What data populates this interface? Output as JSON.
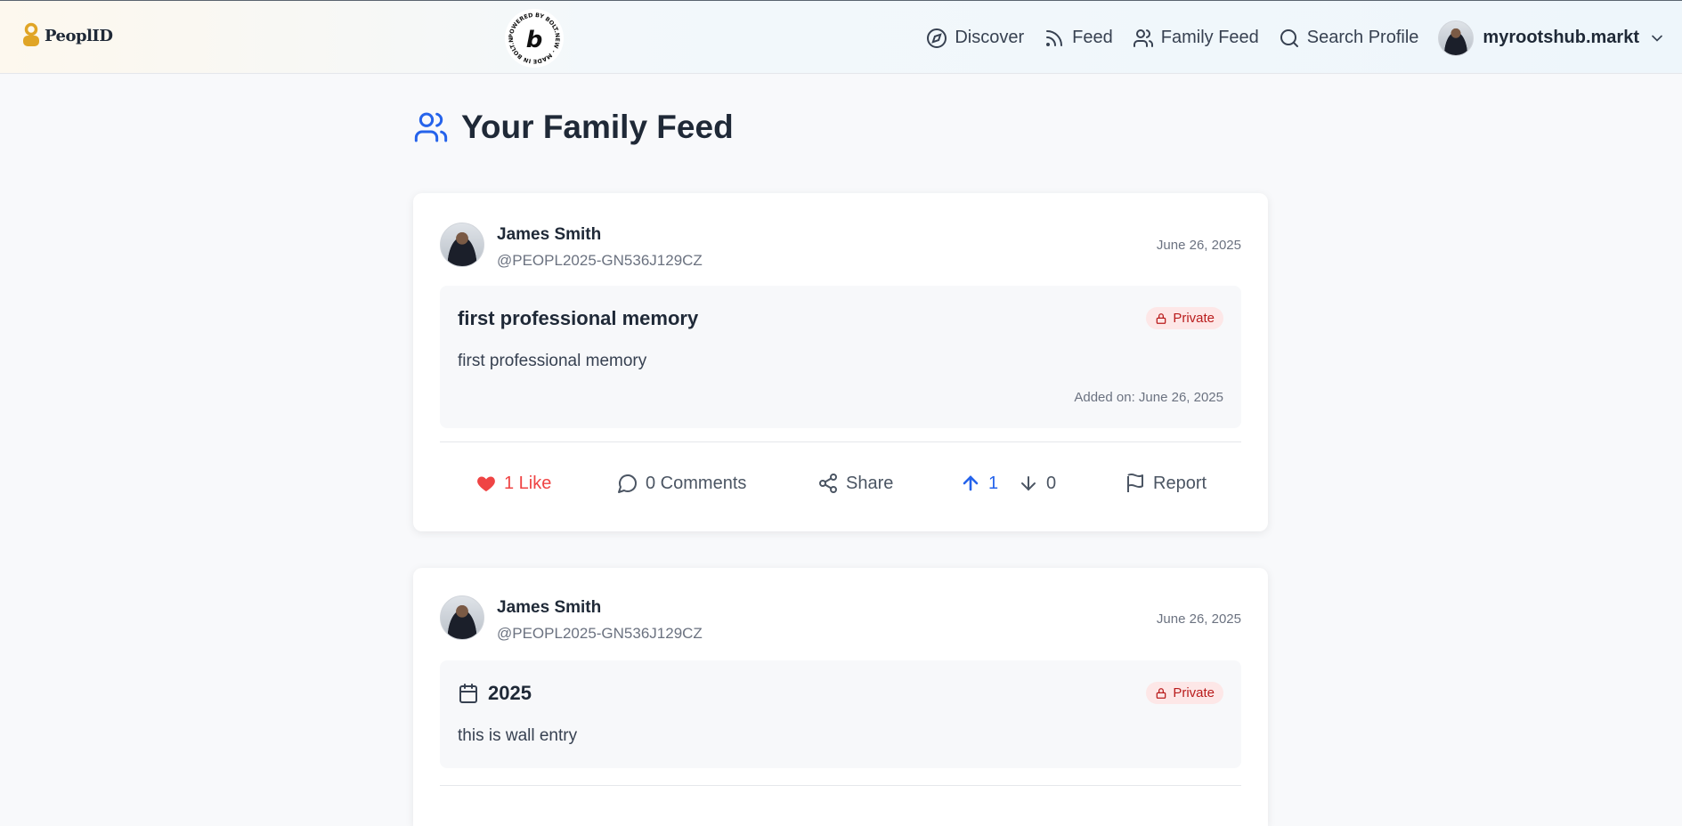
{
  "brand": {
    "name": "PeoplID"
  },
  "badge": {
    "text": "POWERED BY BOLT.NEW · MADE IN BOLT.NEW ·",
    "letter": "b"
  },
  "nav": {
    "items": [
      {
        "label": "Discover",
        "icon": "compass-icon"
      },
      {
        "label": "Feed",
        "icon": "rss-icon"
      },
      {
        "label": "Family Feed",
        "icon": "users-icon"
      },
      {
        "label": "Search Profile",
        "icon": "search-icon"
      }
    ],
    "user": {
      "name": "myrootshub.markt"
    }
  },
  "page": {
    "title": "Your Family Feed"
  },
  "posts": [
    {
      "author": "James Smith",
      "handle": "@PEOPL2025-GN536J129CZ",
      "date": "June 26, 2025",
      "title": "first professional memory",
      "privacy": "Private",
      "body": "first professional memory",
      "added": "Added on: June 26, 2025",
      "actions": {
        "like": "1 Like",
        "comments": "0 Comments",
        "share": "Share",
        "upvotes": "1",
        "downvotes": "0",
        "report": "Report"
      }
    },
    {
      "author": "James Smith",
      "handle": "@PEOPL2025-GN536J129CZ",
      "date": "June 26, 2025",
      "title": "2025",
      "privacy": "Private",
      "body": "this is wall entry"
    }
  ],
  "colors": {
    "accent": "#2563eb",
    "like": "#ef4444",
    "private_bg": "#fde7e7",
    "private_text": "#b91c1c",
    "logo_gold": "#e0a526"
  }
}
